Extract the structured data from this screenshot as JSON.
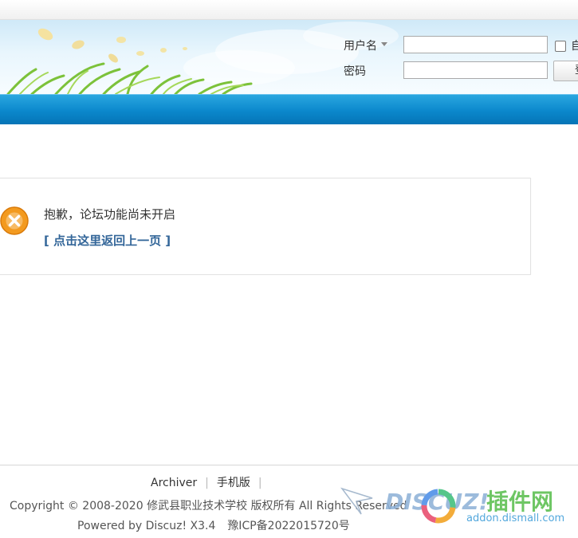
{
  "login": {
    "username_label": "用户名",
    "password_label": "密码",
    "username_value": "",
    "password_value": "",
    "auto_label": "自",
    "submit_label": "登录"
  },
  "message": {
    "text": "抱歉，论坛功能尚未开启",
    "back_link": "[ 点击这里返回上一页 ]"
  },
  "footer": {
    "links": [
      "Archiver",
      "手机版"
    ],
    "separator": "|",
    "copyright": "Copyright © 2008-2020 修武县职业技术学校 版权所有 All Rights Reserved",
    "powered_by": "Powered by Discuz! X3.4",
    "icp": "豫ICP备2022015720号"
  },
  "watermark": {
    "brand_text": "DISCUZ!",
    "cn_text": "插件网",
    "site": "addon.dismall.com"
  },
  "colors": {
    "nav_blue": "#0b88cc",
    "link_blue": "#336699",
    "error_orange": "#f39a1f"
  }
}
